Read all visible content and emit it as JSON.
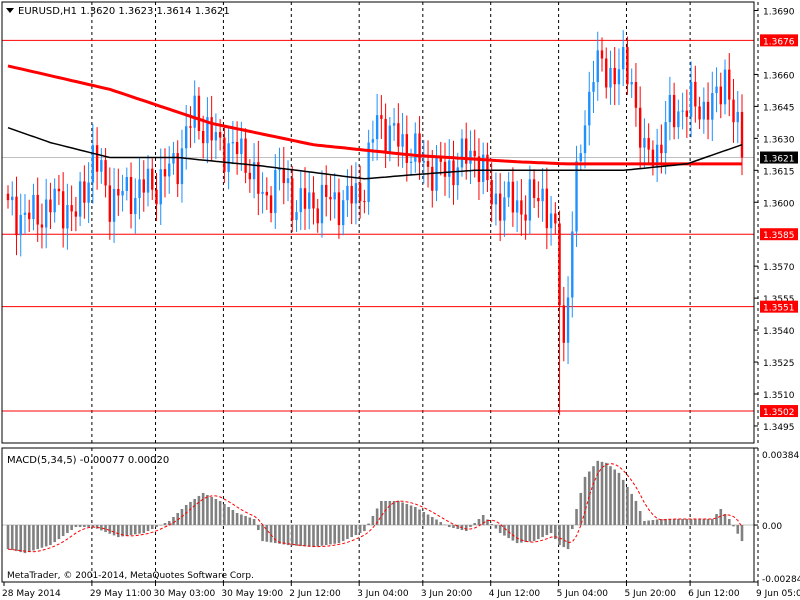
{
  "window": {
    "symbol_header": "EURUSD,H1  1.3620 1.3623 1.3614 1.3621",
    "dropdown_icon": "triangle-down-icon",
    "copyright": "MetaTrader, © 2001-2014, MetaQuotes Software Corp."
  },
  "colors": {
    "background": "#ffffff",
    "frame": "#000000",
    "grid": "#000000",
    "bull_candle": "#1e90ff",
    "bear_candle": "#ff0000",
    "ma_fast": "#ff0000",
    "ma_slow": "#000000",
    "level_line": "#ff0000",
    "macd_hist": "#808080",
    "macd_signal": "#ff0000",
    "price_tag_bg": "#000000"
  },
  "chart_data": [
    {
      "type": "candlestick",
      "title": "EURUSD,H1",
      "ohlc_last": {
        "open": 1.362,
        "high": 1.3623,
        "low": 1.3614,
        "close": 1.3621
      },
      "ylim": [
        1.3487,
        1.3694
      ],
      "y_ticks": [
        "1.3690",
        "1.3676",
        "1.3660",
        "1.3645",
        "1.3630",
        "1.3621",
        "1.3615",
        "1.3600",
        "1.3585",
        "1.3570",
        "1.3555",
        "1.3551",
        "1.3540",
        "1.3525",
        "1.3510",
        "1.3502",
        "1.3495"
      ],
      "x_tick_labels": [
        "28 May 2014",
        "29 May 11:00",
        "30 May 03:00",
        "30 May 19:00",
        "2 Jun 12:00",
        "3 Jun 04:00",
        "3 Jun 20:00",
        "4 Jun 12:00",
        "5 Jun 04:00",
        "5 Jun 20:00",
        "6 Jun 12:00",
        "9 Jun 05:00"
      ],
      "grid": "vertical dotted",
      "horizontal_levels": [
        {
          "label": "1.3676",
          "value": 1.3676
        },
        {
          "label": "1.3585",
          "value": 1.3585
        },
        {
          "label": "1.3551",
          "value": 1.3551
        },
        {
          "label": "1.3502",
          "value": 1.3502
        }
      ],
      "current_price": {
        "label": "1.3621",
        "value": 1.3621
      },
      "candle_count": 174,
      "close_anchors": [
        [
          0,
          1.3596
        ],
        [
          6,
          1.3593
        ],
        [
          12,
          1.3601
        ],
        [
          16,
          1.3593
        ],
        [
          20,
          1.3622
        ],
        [
          24,
          1.3602
        ],
        [
          30,
          1.3605
        ],
        [
          36,
          1.361
        ],
        [
          40,
          1.362
        ],
        [
          44,
          1.3642
        ],
        [
          48,
          1.363
        ],
        [
          52,
          1.3625
        ],
        [
          56,
          1.3622
        ],
        [
          60,
          1.36
        ],
        [
          64,
          1.3613
        ],
        [
          68,
          1.3598
        ],
        [
          72,
          1.36
        ],
        [
          76,
          1.3601
        ],
        [
          80,
          1.36
        ],
        [
          84,
          1.3608
        ],
        [
          87,
          1.364
        ],
        [
          90,
          1.3632
        ],
        [
          94,
          1.3626
        ],
        [
          98,
          1.3618
        ],
        [
          102,
          1.3614
        ],
        [
          106,
          1.3618
        ],
        [
          110,
          1.3624
        ],
        [
          114,
          1.3602
        ],
        [
          118,
          1.36
        ],
        [
          122,
          1.3598
        ],
        [
          126,
          1.3605
        ],
        [
          129,
          1.3582
        ],
        [
          131,
          1.3532
        ],
        [
          133,
          1.359
        ],
        [
          135,
          1.3625
        ],
        [
          138,
          1.3665
        ],
        [
          141,
          1.366
        ],
        [
          144,
          1.3663
        ],
        [
          147,
          1.3658
        ],
        [
          150,
          1.362
        ],
        [
          153,
          1.3625
        ],
        [
          156,
          1.364
        ],
        [
          159,
          1.3645
        ],
        [
          163,
          1.3645
        ],
        [
          167,
          1.3646
        ],
        [
          169,
          1.3662
        ],
        [
          171,
          1.364
        ],
        [
          173,
          1.3621
        ]
      ],
      "low_spike": {
        "index": 130,
        "value": 1.35
      },
      "series": [
        {
          "type": "line",
          "role": "moving-average-fast",
          "values": [
            [
              0,
              1.3664
            ],
            [
              24,
              1.3653
            ],
            [
              48,
              1.3637
            ],
            [
              72,
              1.3627
            ],
            [
              96,
              1.3622
            ],
            [
              120,
              1.3619
            ],
            [
              132,
              1.3618
            ],
            [
              150,
              1.3618
            ],
            [
              173,
              1.3618
            ]
          ]
        },
        {
          "type": "line",
          "role": "moving-average-slow",
          "values": [
            [
              0,
              1.3635
            ],
            [
              10,
              1.3628
            ],
            [
              24,
              1.3621
            ],
            [
              40,
              1.3621
            ],
            [
              60,
              1.3617
            ],
            [
              84,
              1.3611
            ],
            [
              96,
              1.3613
            ],
            [
              110,
              1.3615
            ],
            [
              130,
              1.3615
            ],
            [
              145,
              1.3615
            ],
            [
              160,
              1.3618
            ],
            [
              173,
              1.3627
            ]
          ]
        }
      ]
    },
    {
      "type": "bar",
      "title": "MACD(5,34,5) -0.00077 0.00020",
      "indicator": "MACD",
      "ylim": [
        -0.00284,
        0.00384
      ],
      "y_ticks": [
        "0.00384",
        "0.00",
        "-0.00284"
      ],
      "histogram_anchors": [
        [
          0,
          -0.0012
        ],
        [
          4,
          -0.0014
        ],
        [
          10,
          -0.001
        ],
        [
          16,
          -0.0001
        ],
        [
          20,
          -0.0001
        ],
        [
          26,
          -0.0006
        ],
        [
          32,
          -0.0004
        ],
        [
          38,
          0.0002
        ],
        [
          42,
          0.001
        ],
        [
          46,
          0.0016
        ],
        [
          50,
          0.0012
        ],
        [
          54,
          0.0006
        ],
        [
          58,
          0.0003
        ],
        [
          60,
          -0.0008
        ],
        [
          66,
          -0.001
        ],
        [
          72,
          -0.0011
        ],
        [
          78,
          -0.0009
        ],
        [
          84,
          -0.0003
        ],
        [
          88,
          0.0012
        ],
        [
          92,
          0.0012
        ],
        [
          96,
          0.0009
        ],
        [
          100,
          0.0004
        ],
        [
          104,
          -0.0001
        ],
        [
          108,
          -0.0003
        ],
        [
          112,
          0.0005
        ],
        [
          116,
          -0.0004
        ],
        [
          120,
          -0.0009
        ],
        [
          124,
          -0.0008
        ],
        [
          128,
          -0.0004
        ],
        [
          130,
          -0.001
        ],
        [
          132,
          -0.0012
        ],
        [
          134,
          0.0008
        ],
        [
          136,
          0.0024
        ],
        [
          139,
          0.0032
        ],
        [
          141,
          0.0031
        ],
        [
          144,
          0.0026
        ],
        [
          148,
          0.0012
        ],
        [
          150,
          0.0002
        ],
        [
          154,
          0.0003
        ],
        [
          158,
          0.0003
        ],
        [
          162,
          0.0003
        ],
        [
          166,
          0.0003
        ],
        [
          168,
          0.0008
        ],
        [
          170,
          0.0003
        ],
        [
          173,
          -0.0008
        ]
      ],
      "signal_smoothing": 5
    }
  ]
}
